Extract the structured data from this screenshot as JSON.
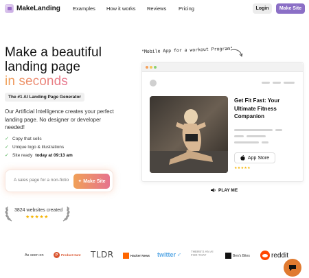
{
  "nav": {
    "logo_text": "MakeLanding",
    "links": [
      "Examples",
      "How it works",
      "Reviews",
      "Pricing"
    ],
    "login_label": "Login",
    "make_site_label": "Make Site"
  },
  "hero": {
    "headline_line1": "Make a beautiful",
    "headline_line2": "landing page",
    "headline_line3": "in seconds",
    "pill": "The #1 AI Landing Page Generator",
    "description": "Our Artificial Intelligence creates your perfect landing page. No designer or developer needed!",
    "checks": [
      {
        "text": "Copy that sells"
      },
      {
        "text": "Unique logo & illustrations"
      },
      {
        "text": "Site ready",
        "bold": "today at 09:13 am"
      }
    ],
    "prompt_placeholder": "A sales page for a non-fiction",
    "prompt_button": "Make Site"
  },
  "social_proof": {
    "count_text": "3824 websites created",
    "stars": "★★★★★"
  },
  "mockup": {
    "handwritten": "\"Mobile App for a workout Program\"",
    "title": "Get Fit Fast: Your Ultimate Fitness Companion",
    "app_store_label": "App Store",
    "stars": "★★★★★",
    "play_label": "PLAY ME"
  },
  "seen_on": {
    "label": "As seen on",
    "brands": [
      "Product Hunt",
      "TLDR",
      "Hacker News",
      "twitter",
      "THERE'S AN AI FOR THAT",
      "Ben's Bites",
      "reddit"
    ]
  },
  "colors": {
    "accent_purple": "#8b6fc6",
    "gradient_start": "#f0a057",
    "gradient_end": "#e6738e",
    "chat_bubble": "#e07a2f"
  }
}
